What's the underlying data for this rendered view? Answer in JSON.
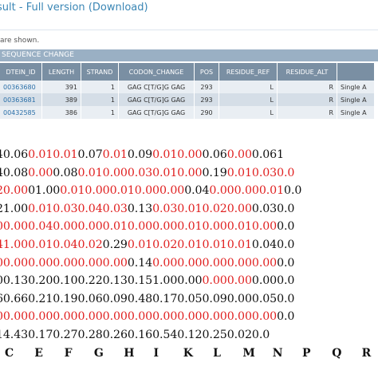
{
  "page": {
    "title_prefix": "sult - ",
    "full_version_link": "Full version",
    "download_link": "(Download)",
    "subtitle": "are shown.",
    "section_header": "SEQUENCE CHANGE"
  },
  "table": {
    "columns": [
      "DTEIN_ID",
      "LENGTH",
      "STRAND",
      "CODON_CHANGE",
      "POS",
      "RESIDUE_REF",
      "RESIDUE_ALT",
      ""
    ],
    "rows": [
      [
        "00363680",
        "391",
        "1",
        "GAG C[T/G]G GAG",
        "293",
        "L",
        "R",
        "Single A"
      ],
      [
        "00363681",
        "389",
        "1",
        "GAG C[T/G]G GAG",
        "293",
        "L",
        "R",
        "Single A"
      ],
      [
        "00432585",
        "386",
        "1",
        "GAG C[T/G]G GAG",
        "290",
        "L",
        "R",
        "Single A"
      ]
    ]
  },
  "matrix": {
    "black_color": "#111111",
    "red_color": "#e02020",
    "rows": [
      [
        [
          "b",
          "04"
        ],
        [
          "b",
          "0.06"
        ],
        [
          "r",
          "0.01"
        ],
        [
          "r",
          "0.01"
        ],
        [
          "b",
          "0.07"
        ],
        [
          "r",
          "0.01"
        ],
        [
          "b",
          "0.09"
        ],
        [
          "r",
          "0.01"
        ],
        [
          "r",
          "0.00"
        ],
        [
          "b",
          "0.06"
        ],
        [
          "r",
          "0.00"
        ],
        [
          "b",
          "0.06"
        ],
        [
          "b",
          "1"
        ]
      ],
      [
        [
          "b",
          "1"
        ],
        [
          "b",
          "40.08"
        ],
        [
          "r",
          "0.00"
        ],
        [
          "b",
          "0.08"
        ],
        [
          "r",
          "0.01"
        ],
        [
          "r",
          "0.00"
        ],
        [
          "r",
          "0.03"
        ],
        [
          "r",
          "0.01"
        ],
        [
          "r",
          "0.00"
        ],
        [
          "b",
          "0.19"
        ],
        [
          "r",
          "0.01"
        ],
        [
          "r",
          "0.03"
        ],
        [
          "r",
          "0.0"
        ]
      ],
      [
        [
          "b",
          "0"
        ],
        [
          "r",
          "20.00"
        ],
        [
          "b",
          "01.00"
        ],
        [
          "r",
          "0.01"
        ],
        [
          "r",
          "0.00"
        ],
        [
          "r",
          "0.01"
        ],
        [
          "r",
          "0.00"
        ],
        [
          "r",
          "0.00"
        ],
        [
          "b",
          "0.04"
        ],
        [
          "r",
          "0.00"
        ],
        [
          "r",
          "0.00"
        ],
        [
          "r",
          "0.01"
        ],
        [
          "b",
          "0.0"
        ]
      ],
      [
        [
          "b",
          "0"
        ],
        [
          "b",
          "21.00"
        ],
        [
          "r",
          "0.01"
        ],
        [
          "r",
          "0.03"
        ],
        [
          "r",
          "0.04"
        ],
        [
          "r",
          "0.03"
        ],
        [
          "b",
          "0.13"
        ],
        [
          "r",
          "0.03"
        ],
        [
          "r",
          "0.01"
        ],
        [
          "r",
          "0.02"
        ],
        [
          "r",
          "0.00"
        ],
        [
          "b",
          "0.03"
        ],
        [
          "b",
          "0.0"
        ]
      ],
      [
        [
          "b",
          "0"
        ],
        [
          "r",
          "00.00"
        ],
        [
          "r",
          "0.04"
        ],
        [
          "r",
          "0.00"
        ],
        [
          "r",
          "0.00"
        ],
        [
          "r",
          "0.01"
        ],
        [
          "r",
          "0.00"
        ],
        [
          "r",
          "0.00"
        ],
        [
          "r",
          "0.01"
        ],
        [
          "r",
          "0.00"
        ],
        [
          "r",
          "0.01"
        ],
        [
          "r",
          "0.00"
        ],
        [
          "b",
          "0.0"
        ]
      ],
      [
        [
          "b",
          "0"
        ],
        [
          "r",
          "41.00"
        ],
        [
          "r",
          "0.01"
        ],
        [
          "r",
          "0.04"
        ],
        [
          "r",
          "0.02"
        ],
        [
          "b",
          "0.29"
        ],
        [
          "r",
          "0.01"
        ],
        [
          "r",
          "0.02"
        ],
        [
          "r",
          "0.01"
        ],
        [
          "r",
          "0.01"
        ],
        [
          "r",
          "0.01"
        ],
        [
          "b",
          "0.04"
        ],
        [
          "b",
          "0.0"
        ]
      ],
      [
        [
          "b",
          "0"
        ],
        [
          "r",
          "00.00"
        ],
        [
          "r",
          "0.00"
        ],
        [
          "r",
          "0.00"
        ],
        [
          "r",
          "0.00"
        ],
        [
          "r",
          "0.00"
        ],
        [
          "b",
          "0.14"
        ],
        [
          "r",
          "0.00"
        ],
        [
          "r",
          "0.00"
        ],
        [
          "r",
          "0.00"
        ],
        [
          "r",
          "0.00"
        ],
        [
          "r",
          "0.00"
        ],
        [
          "b",
          "0.0"
        ]
      ],
      [
        [
          "b",
          "0"
        ],
        [
          "b",
          "00.13"
        ],
        [
          "b",
          "0.20"
        ],
        [
          "b",
          "0.10"
        ],
        [
          "b",
          "0.22"
        ],
        [
          "b",
          "0.13"
        ],
        [
          "b",
          "0.15"
        ],
        [
          "b",
          "1.00"
        ],
        [
          "b",
          "0.00"
        ],
        [
          "r",
          "0.00"
        ],
        [
          "r",
          "0.00"
        ],
        [
          "b",
          "0.00"
        ],
        [
          "b",
          "0.0"
        ]
      ],
      [
        [
          "b",
          "3"
        ],
        [
          "b",
          "60.66"
        ],
        [
          "b",
          "0.21"
        ],
        [
          "b",
          "0.19"
        ],
        [
          "b",
          "0.06"
        ],
        [
          "b",
          "0.09"
        ],
        [
          "b",
          "0.48"
        ],
        [
          "b",
          "0.17"
        ],
        [
          "b",
          "0.05"
        ],
        [
          "b",
          "0.09"
        ],
        [
          "b",
          "0.00"
        ],
        [
          "b",
          "0.05"
        ],
        [
          "b",
          "0.0"
        ]
      ],
      [
        [
          "b",
          "0"
        ],
        [
          "r",
          "00.00"
        ],
        [
          "r",
          "0.00"
        ],
        [
          "r",
          "0.00"
        ],
        [
          "r",
          "0.00"
        ],
        [
          "r",
          "0.00"
        ],
        [
          "r",
          "0.00"
        ],
        [
          "r",
          "0.00"
        ],
        [
          "r",
          "0.00"
        ],
        [
          "r",
          "0.00"
        ],
        [
          "r",
          "0.00"
        ],
        [
          "r",
          "0.00"
        ],
        [
          "b",
          "0.0"
        ]
      ],
      [
        [
          "b",
          "4"
        ],
        [
          "b",
          "1"
        ],
        [
          "b",
          "4.43"
        ],
        [
          "b",
          "0.17"
        ],
        [
          "b",
          "0.27"
        ],
        [
          "b",
          "0.28"
        ],
        [
          "b",
          "0.26"
        ],
        [
          "b",
          "0.16"
        ],
        [
          "b",
          "0.54"
        ],
        [
          "b",
          "0.12"
        ],
        [
          "b",
          "0.25"
        ],
        [
          "b",
          "0.02"
        ],
        [
          "b",
          "0.0"
        ]
      ]
    ],
    "letters": [
      "C",
      "E",
      "F",
      "G",
      "H",
      "I",
      "K",
      "L",
      "M",
      "N",
      "P",
      "Q",
      "R"
    ]
  }
}
